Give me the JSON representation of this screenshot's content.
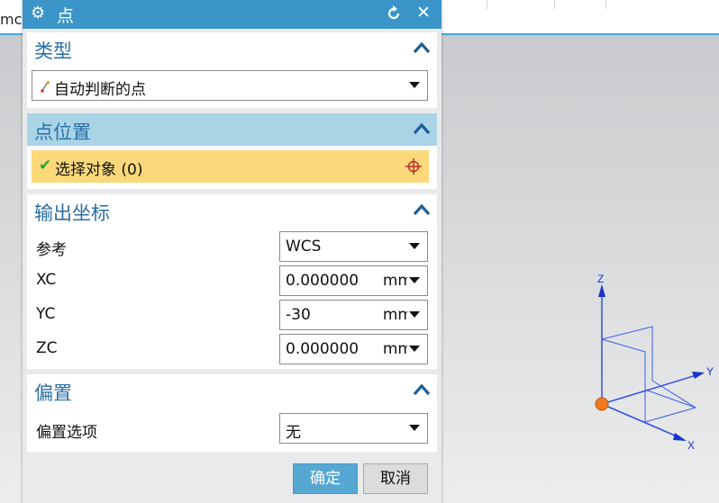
{
  "app": {
    "tab_text_fragment": "mc",
    "axis_labels": {
      "z": "Z",
      "y": "Y",
      "x": "X"
    }
  },
  "dialog": {
    "title": "点",
    "sections": {
      "type": {
        "title": "类型",
        "dropdown_value": "自动判断的点"
      },
      "point_location": {
        "title": "点位置",
        "select_object_label": "选择对象 (0)"
      },
      "output_coords": {
        "title": "输出坐标",
        "rows": [
          {
            "label": "参考",
            "value": "WCS",
            "unit": ""
          },
          {
            "label": "XC",
            "value": "0.000000",
            "unit": "mm"
          },
          {
            "label": "YC",
            "value": "-30",
            "unit": "mm"
          },
          {
            "label": "ZC",
            "value": "0.000000",
            "unit": "mm"
          }
        ]
      },
      "offset": {
        "title": "偏置",
        "rows": [
          {
            "label": "偏置选项",
            "value": "无"
          }
        ]
      }
    },
    "buttons": {
      "ok": "确定",
      "cancel": "取消"
    }
  },
  "colors": {
    "titlebar": "#3b95c9",
    "active_section": "#a8d4e6",
    "selection_highlight": "#fbd97a",
    "ok_button": "#56a8d3"
  }
}
